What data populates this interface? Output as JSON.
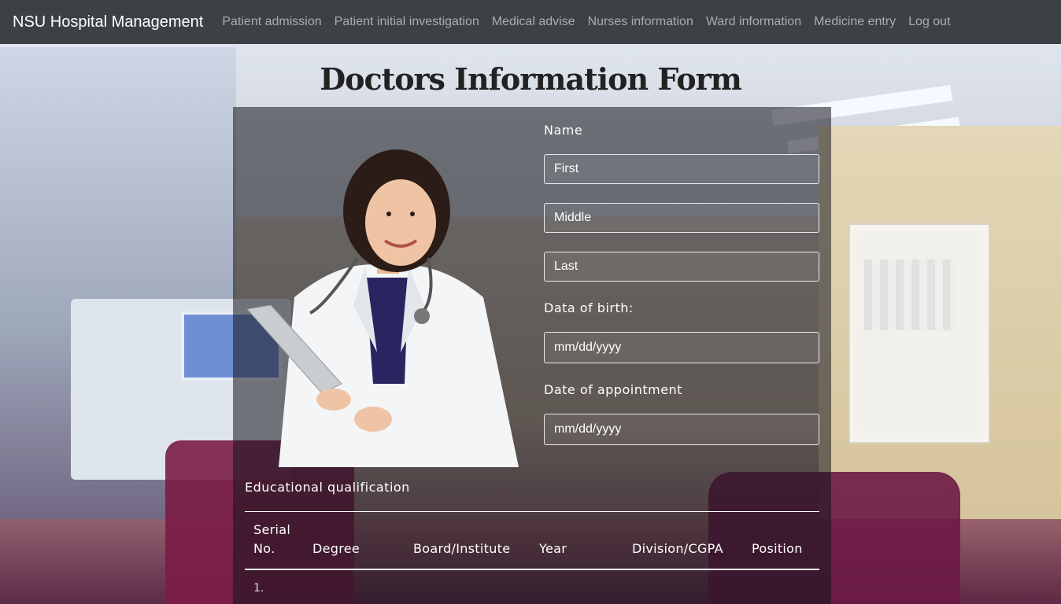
{
  "navbar": {
    "brand": "NSU Hospital Management",
    "links": [
      "Patient admission",
      "Patient initial investigation",
      "Medical advise",
      "Nurses information",
      "Ward information",
      "Medicine entry",
      "Log out"
    ]
  },
  "page": {
    "title": "Doctors Information Form"
  },
  "form": {
    "name_label": "Name",
    "first_placeholder": "First",
    "middle_placeholder": "Middle",
    "last_placeholder": "Last",
    "dob_label": "Data of birth:",
    "dob_placeholder": "mm/dd/yyyy",
    "appointment_label": "Date of appointment",
    "appointment_placeholder": "mm/dd/yyyy"
  },
  "education": {
    "title": "Educational qualification",
    "headers": {
      "serial_line1": "Serial",
      "serial_line2": "No.",
      "degree": "Degree",
      "board": "Board/Institute",
      "year": "Year",
      "division": "Division/CGPA",
      "position": "Position"
    },
    "rows": [
      {
        "serial": "1."
      }
    ]
  },
  "colors": {
    "navbar_bg": "#3d4044",
    "nav_link": "#a9adb2",
    "brand": "#ffffff"
  },
  "icons": {
    "doctor_image": "doctor-photo"
  }
}
